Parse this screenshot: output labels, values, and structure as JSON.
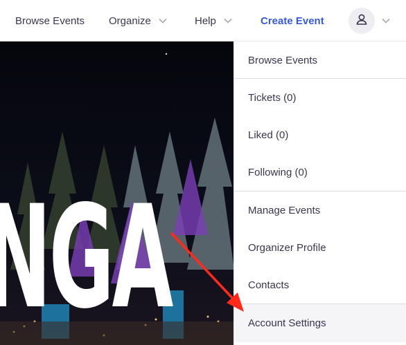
{
  "nav": {
    "browse_label": "Browse Events",
    "organize_label": "Organize",
    "help_label": "Help",
    "create_label": "Create Event",
    "create_color": "#3659e3"
  },
  "account": {
    "icon": "user-icon"
  },
  "hero": {
    "text": "NGA"
  },
  "menu": {
    "items": [
      {
        "label": "Browse Events"
      },
      {
        "label": "Tickets (0)"
      },
      {
        "label": "Liked (0)"
      },
      {
        "label": "Following (0)"
      },
      {
        "label": "Manage Events"
      },
      {
        "label": "Organizer Profile"
      },
      {
        "label": "Contacts"
      },
      {
        "label": "Account Settings",
        "highlighted": true
      }
    ]
  },
  "annotation": {
    "arrow_color": "#ff2a1a",
    "arrow_target": "Account Settings"
  }
}
